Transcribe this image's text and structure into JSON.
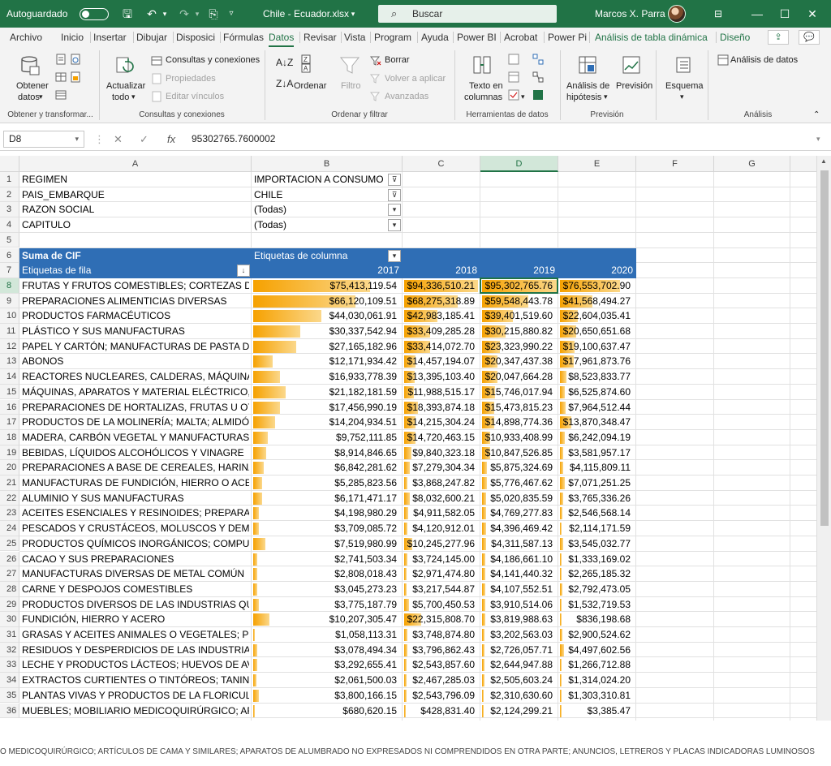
{
  "titlebar": {
    "autosave_label": "Autoguardado",
    "filename": "Chile - Ecuador.xlsx",
    "search_label": "Buscar",
    "user_name": "Marcos X. Parra"
  },
  "ribbon_tabs": [
    {
      "label": "Archivo"
    },
    {
      "label": "Inicio"
    },
    {
      "label": "Insertar"
    },
    {
      "label": "Dibujar"
    },
    {
      "label": "Disposici"
    },
    {
      "label": "Fórmulas"
    },
    {
      "label": "Datos"
    },
    {
      "label": "Revisar"
    },
    {
      "label": "Vista"
    },
    {
      "label": "Program"
    },
    {
      "label": "Ayuda"
    },
    {
      "label": "Power BI"
    },
    {
      "label": "Acrobat"
    },
    {
      "label": "Power Pi"
    },
    {
      "label": "Análisis de tabla dinámica"
    },
    {
      "label": "Diseño"
    }
  ],
  "ribbon": {
    "obtener": "Obtener",
    "datos": "datos",
    "g1": "Obtener y transformar...",
    "actualizar": "Actualizar",
    "todo": "todo",
    "consultas": "Consultas y conexiones",
    "propiedades": "Propiedades",
    "editar": "Editar vínculos",
    "g2": "Consultas y conexiones",
    "ordenar": "Ordenar",
    "filtro": "Filtro",
    "borrar": "Borrar",
    "volver": "Volver a aplicar",
    "avanzadas": "Avanzadas",
    "g3": "Ordenar y filtrar",
    "texto_en": "Texto en",
    "columnas": "columnas",
    "g4": "Herramientas de datos",
    "analisis_hip": "Análisis de",
    "hipotesis": "hipótesis",
    "prevision": "Previsión",
    "g5": "Previsión",
    "esquema": "Esquema",
    "analisis_datos": "Análisis de datos",
    "g6": "Análisis"
  },
  "formula_bar": {
    "cell_ref": "D8",
    "fx": "fx",
    "value": "95302765.7600002"
  },
  "columns": [
    "A",
    "B",
    "C",
    "D",
    "E",
    "F",
    "G",
    "H"
  ],
  "selected_column": "D",
  "selected_row": 8,
  "filters": [
    {
      "label": "REGIMEN",
      "value": "IMPORTACION A CONSUMO"
    },
    {
      "label": "PAIS_EMBARQUE",
      "value": "CHILE"
    },
    {
      "label": "RAZON SOCIAL",
      "value": "(Todas)"
    },
    {
      "label": "CAPITULO",
      "value": "(Todas)"
    }
  ],
  "pivot": {
    "sum_label": "Suma de CIF",
    "col_labels": "Etiquetas de columna",
    "row_labels": "Etiquetas de fila",
    "years": [
      "2017",
      "2018",
      "2019",
      "2020"
    ],
    "rows": [
      {
        "label": "FRUTAS Y FRUTOS COMESTIBLES; CORTEZAS DE AG",
        "v": [
          "$75,413,119.54",
          "$94,336,510.21",
          "$95,302,765.76",
          "$76,553,702.90"
        ],
        "b": [
          0.79,
          0.99,
          1.0,
          0.8
        ]
      },
      {
        "label": "PREPARACIONES ALIMENTICIAS DIVERSAS",
        "v": [
          "$66,120,109.51",
          "$68,275,318.89",
          "$59,548,443.78",
          "$41,568,494.27"
        ],
        "b": [
          0.69,
          0.72,
          0.62,
          0.44
        ]
      },
      {
        "label": "PRODUCTOS FARMACÉUTICOS",
        "v": [
          "$44,030,061.91",
          "$42,983,185.41",
          "$39,401,519.60",
          "$22,604,035.41"
        ],
        "b": [
          0.46,
          0.45,
          0.41,
          0.24
        ]
      },
      {
        "label": "PLÁSTICO Y SUS MANUFACTURAS",
        "v": [
          "$30,337,542.94",
          "$33,409,285.28",
          "$30,215,880.82",
          "$20,650,651.68"
        ],
        "b": [
          0.32,
          0.35,
          0.32,
          0.22
        ]
      },
      {
        "label": "PAPEL Y CARTÓN; MANUFACTURAS DE PASTA DE C",
        "v": [
          "$27,165,182.96",
          "$33,414,072.70",
          "$23,323,990.22",
          "$19,100,637.47"
        ],
        "b": [
          0.29,
          0.35,
          0.24,
          0.2
        ]
      },
      {
        "label": "ABONOS",
        "v": [
          "$12,171,934.42",
          "$14,457,194.07",
          "$20,347,437.38",
          "$17,961,873.76"
        ],
        "b": [
          0.13,
          0.15,
          0.21,
          0.19
        ]
      },
      {
        "label": "REACTORES NUCLEARES, CALDERAS, MÁQUINAS, A",
        "v": [
          "$16,933,778.39",
          "$13,395,103.40",
          "$20,047,664.28",
          "$8,523,833.77"
        ],
        "b": [
          0.18,
          0.14,
          0.21,
          0.09
        ]
      },
      {
        "label": "MÁQUINAS, APARATOS Y MATERIAL ELÉCTRICO, Y",
        "v": [
          "$21,182,181.59",
          "$11,988,515.17",
          "$15,746,017.94",
          "$6,525,874.60"
        ],
        "b": [
          0.22,
          0.13,
          0.17,
          0.07
        ]
      },
      {
        "label": "PREPARACIONES DE HORTALIZAS, FRUTAS U OTRO",
        "v": [
          "$17,456,990.19",
          "$18,393,874.18",
          "$15,473,815.23",
          "$7,964,512.44"
        ],
        "b": [
          0.18,
          0.19,
          0.16,
          0.08
        ]
      },
      {
        "label": "PRODUCTOS DE LA MOLINERÍA; MALTA; ALMIDÓN",
        "v": [
          "$14,204,934.51",
          "$14,215,304.24",
          "$14,898,774.36",
          "$13,870,348.47"
        ],
        "b": [
          0.15,
          0.15,
          0.16,
          0.15
        ]
      },
      {
        "label": "MADERA, CARBÓN VEGETAL Y MANUFACTURAS DE",
        "v": [
          "$9,752,111.85",
          "$14,720,463.15",
          "$10,933,408.99",
          "$6,242,094.19"
        ],
        "b": [
          0.1,
          0.15,
          0.11,
          0.07
        ]
      },
      {
        "label": "BEBIDAS, LÍQUIDOS ALCOHÓLICOS Y VINAGRE",
        "v": [
          "$8,914,846.65",
          "$9,840,323.18",
          "$10,847,526.85",
          "$3,581,957.17"
        ],
        "b": [
          0.09,
          0.1,
          0.11,
          0.04
        ]
      },
      {
        "label": "PREPARACIONES A BASE DE CEREALES, HARINA, A",
        "v": [
          "$6,842,281.62",
          "$7,279,304.34",
          "$5,875,324.69",
          "$4,115,809.11"
        ],
        "b": [
          0.07,
          0.08,
          0.06,
          0.04
        ]
      },
      {
        "label": "MANUFACTURAS DE FUNDICIÓN, HIERRO O ACERO",
        "v": [
          "$5,285,823.56",
          "$3,868,247.82",
          "$5,776,467.62",
          "$7,071,251.25"
        ],
        "b": [
          0.06,
          0.04,
          0.06,
          0.07
        ]
      },
      {
        "label": "ALUMINIO Y SUS MANUFACTURAS",
        "v": [
          "$6,171,471.17",
          "$8,032,600.21",
          "$5,020,835.59",
          "$3,765,336.26"
        ],
        "b": [
          0.06,
          0.08,
          0.05,
          0.04
        ]
      },
      {
        "label": "ACEITES ESENCIALES Y RESINOIDES; PREPARACION",
        "v": [
          "$4,198,980.29",
          "$4,911,582.05",
          "$4,769,277.83",
          "$2,546,568.14"
        ],
        "b": [
          0.04,
          0.05,
          0.05,
          0.03
        ]
      },
      {
        "label": "PESCADOS Y CRUSTÁCEOS, MOLUSCOS Y DEMÁS IN",
        "v": [
          "$3,709,085.72",
          "$4,120,912.01",
          "$4,396,469.42",
          "$2,114,171.59"
        ],
        "b": [
          0.04,
          0.04,
          0.05,
          0.02
        ]
      },
      {
        "label": "PRODUCTOS QUÍMICOS INORGÁNICOS; COMPUES",
        "v": [
          "$7,519,980.99",
          "$10,245,277.96",
          "$4,311,587.13",
          "$3,545,032.77"
        ],
        "b": [
          0.08,
          0.11,
          0.05,
          0.04
        ]
      },
      {
        "label": "CACAO Y SUS PREPARACIONES",
        "v": [
          "$2,741,503.34",
          "$3,724,145.00",
          "$4,186,661.10",
          "$1,333,169.02"
        ],
        "b": [
          0.03,
          0.04,
          0.04,
          0.01
        ]
      },
      {
        "label": "MANUFACTURAS DIVERSAS DE METAL COMÚN",
        "v": [
          "$2,808,018.43",
          "$2,971,474.80",
          "$4,141,440.32",
          "$2,265,185.32"
        ],
        "b": [
          0.03,
          0.03,
          0.04,
          0.02
        ]
      },
      {
        "label": "CARNE Y DESPOJOS COMESTIBLES",
        "v": [
          "$3,045,273.23",
          "$3,217,544.87",
          "$4,107,552.51",
          "$2,792,473.05"
        ],
        "b": [
          0.03,
          0.03,
          0.04,
          0.03
        ]
      },
      {
        "label": "PRODUCTOS DIVERSOS DE LAS INDUSTRIAS QUÍMI",
        "v": [
          "$3,775,187.79",
          "$5,700,450.53",
          "$3,910,514.06",
          "$1,532,719.53"
        ],
        "b": [
          0.04,
          0.06,
          0.04,
          0.02
        ]
      },
      {
        "label": "FUNDICIÓN, HIERRO Y ACERO",
        "v": [
          "$10,207,305.47",
          "$22,315,808.70",
          "$3,819,988.63",
          "$836,198.68"
        ],
        "b": [
          0.11,
          0.23,
          0.04,
          0.01
        ]
      },
      {
        "label": "GRASAS Y ACEITES ANIMALES O VEGETALES; PROD",
        "v": [
          "$1,058,113.31",
          "$3,748,874.80",
          "$3,202,563.03",
          "$2,900,524.62"
        ],
        "b": [
          0.01,
          0.04,
          0.03,
          0.03
        ]
      },
      {
        "label": "RESIDUOS Y DESPERDICIOS DE LAS INDUSTRIAS AL",
        "v": [
          "$3,078,494.34",
          "$3,796,862.43",
          "$2,726,057.71",
          "$4,497,602.56"
        ],
        "b": [
          0.03,
          0.04,
          0.03,
          0.05
        ]
      },
      {
        "label": "LECHE Y PRODUCTOS LÁCTEOS; HUEVOS DE AVE; M",
        "v": [
          "$3,292,655.41",
          "$2,543,857.60",
          "$2,644,947.88",
          "$1,266,712.88"
        ],
        "b": [
          0.03,
          0.03,
          0.03,
          0.01
        ]
      },
      {
        "label": "EXTRACTOS CURTIENTES O TINTÓREOS; TANINOS Y",
        "v": [
          "$2,061,500.03",
          "$2,467,285.03",
          "$2,505,603.24",
          "$1,314,024.20"
        ],
        "b": [
          0.02,
          0.03,
          0.03,
          0.01
        ]
      },
      {
        "label": "PLANTAS VIVAS Y PRODUCTOS DE LA FLORICULTUR",
        "v": [
          "$3,800,166.15",
          "$2,543,796.09",
          "$2,310,630.60",
          "$1,303,310.81"
        ],
        "b": [
          0.04,
          0.03,
          0.02,
          0.01
        ]
      },
      {
        "label": "MUEBLES; MOBILIARIO MEDICOQUIRÚRGICO; ART",
        "v": [
          "$680,620.15",
          "$428,831.40",
          "$2,124,299.21",
          "$3,385.47"
        ],
        "b": [
          0.007,
          0.004,
          0.02,
          0.0
        ]
      }
    ]
  },
  "overflow_text": "O MEDICOQUIRÚRGICO; ARTÍCULOS DE CAMA Y SIMILARES; APARATOS DE ALUMBRADO NO EXPRESADOS NI COMPRENDIDOS EN OTRA PARTE; ANUNCIOS, LETREROS Y PLACAS INDICADORAS LUMINOSOS",
  "colors": {
    "accent": "#217346",
    "pivot_header": "#2f6eb5",
    "bar_start": "#f6a100",
    "bar_end": "#fbd88b"
  }
}
